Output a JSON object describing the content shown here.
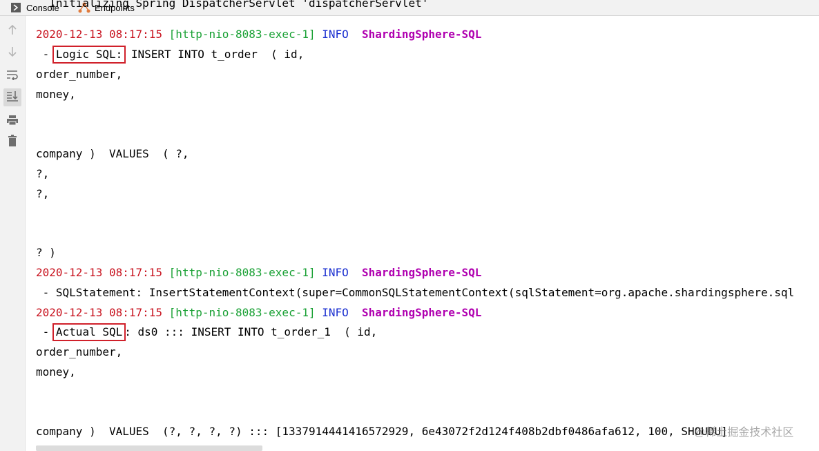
{
  "tabs": {
    "console_label": "Console",
    "endpoints_label": "Endpoints"
  },
  "gutter": {
    "buttons": [
      "up-arrow-icon",
      "down-arrow-icon",
      "soft-wrap-icon",
      "scroll-to-end-icon",
      "print-icon",
      "trash-icon"
    ]
  },
  "console": {
    "top_cut_line": "  Initializing Spring DispatcherServlet 'dispatcherServlet'",
    "log1": {
      "timestamp": "2020-12-13 08:17:15",
      "thread": "[http-nio-8083-exec-1]",
      "level": "INFO",
      "logger": "ShardingSphere-SQL"
    },
    "logic_prefix": " - ",
    "logic_label": "Logic SQL:",
    "logic_rest": " INSERT INTO t_order  ( id,",
    "l_order_number": "order_number,",
    "l_money": "money,",
    "l_company_values": "company )  VALUES  ( ?,",
    "l_q1": "?,",
    "l_q2": "?,",
    "l_q_close": "? )",
    "log2": {
      "timestamp": "2020-12-13 08:17:15",
      "thread": "[http-nio-8083-exec-1]",
      "level": "INFO",
      "logger": "ShardingSphere-SQL"
    },
    "sqlstatement_line": " - SQLStatement: InsertStatementContext(super=CommonSQLStatementContext(sqlStatement=org.apache.shardingsphere.sql",
    "log3": {
      "timestamp": "2020-12-13 08:17:15",
      "thread": "[http-nio-8083-exec-1]",
      "level": "INFO",
      "logger": "ShardingSphere-SQL"
    },
    "actual_prefix": " - ",
    "actual_label": "Actual SQL",
    "actual_rest": ": ds0 ::: INSERT INTO t_order_1  ( id,",
    "a_order_number": "order_number,",
    "a_money": "money,",
    "a_company_values": "company )  VALUES  (?, ?, ?, ?) ::: [1337914441416572929, 6e43072f2d124f408b2dbf0486afa612, 100, SHOUDU]"
  },
  "watermark": "@稀土掘金技术社区",
  "colors": {
    "timestamp": "#c8131f",
    "thread": "#18a033",
    "level": "#1a2fd0",
    "logger": "#b000b0",
    "highlight_box": "#d0202a"
  }
}
